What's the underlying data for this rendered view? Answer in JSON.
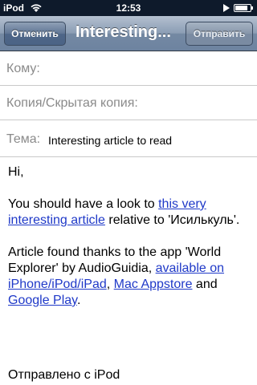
{
  "status_bar": {
    "carrier": "iPod",
    "time": "12:53",
    "battery_level": 0.85,
    "icons": [
      "wifi-icon",
      "play-icon",
      "battery-icon"
    ]
  },
  "nav": {
    "cancel_label": "Отменить",
    "title": "Interesting...",
    "send_label": "Отправить"
  },
  "fields": {
    "to_label": "Кому:",
    "cc_label": "Копия/Скрытая копия:",
    "subject_label": "Тема:",
    "subject_value": "Interesting article to read"
  },
  "body": {
    "greeting": "Hi,",
    "p1_before": "You should have a look to ",
    "p1_link": "this very interesting article",
    "p1_after": " relative to 'Исилькуль'.",
    "p2_before": "Article found thanks to the app 'World Explorer' by AudioGuidia, ",
    "p2_link1": "available on iPhone/iPod/iPad",
    "p2_sep1": ", ",
    "p2_link2": "Mac Appstore",
    "p2_sep2": " and ",
    "p2_link3": "Google Play",
    "p2_end": ".",
    "signature": "Отправлено с iPod"
  },
  "colors": {
    "link": "#1f39c8",
    "label": "#8a8a8a",
    "status_bar": "#0e1a2b"
  }
}
